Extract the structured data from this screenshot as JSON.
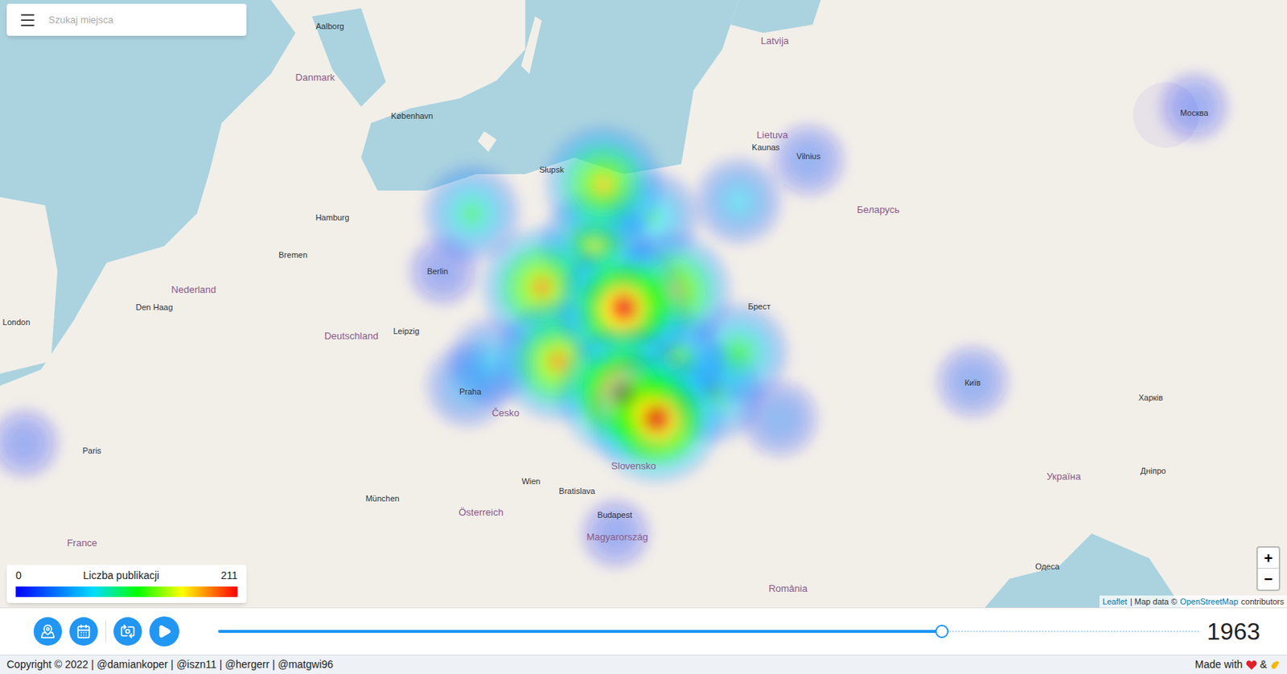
{
  "search": {
    "placeholder": "Szukaj miejsca"
  },
  "legend": {
    "min": "0",
    "title": "Liczba publikacji",
    "max": "211"
  },
  "zoom": {
    "in": "+",
    "out": "−"
  },
  "attribution": [
    "Leaflet",
    "| Map data ©",
    "OpenStreetMap",
    "contributors"
  ],
  "map_labels": [
    {
      "text": "Aalborg",
      "kind": "city"
    },
    {
      "text": "Danmark",
      "kind": "country"
    },
    {
      "text": "København",
      "kind": "city"
    },
    {
      "text": "Hamburg",
      "kind": "city"
    },
    {
      "text": "Bremen",
      "kind": "city"
    },
    {
      "text": "Berlin",
      "kind": "city"
    },
    {
      "text": "Nederland",
      "kind": "country"
    },
    {
      "text": "Den Haag",
      "kind": "city"
    },
    {
      "text": "London",
      "kind": "city"
    },
    {
      "text": "Deutschland",
      "kind": "country"
    },
    {
      "text": "Leipzig",
      "kind": "city"
    },
    {
      "text": "Praha",
      "kind": "city"
    },
    {
      "text": "Paris",
      "kind": "city"
    },
    {
      "text": "München",
      "kind": "city"
    },
    {
      "text": "Wien",
      "kind": "city"
    },
    {
      "text": "Bratislava",
      "kind": "city"
    },
    {
      "text": "Budapest",
      "kind": "city"
    },
    {
      "text": "Magyarország",
      "kind": "country"
    },
    {
      "text": "Słupsk",
      "kind": "city"
    },
    {
      "text": "Lietuva",
      "kind": "country"
    },
    {
      "text": "Vilnius",
      "kind": "city"
    },
    {
      "text": "Latvija",
      "kind": "country"
    },
    {
      "text": "Беларусь",
      "kind": "country"
    },
    {
      "text": "Україна",
      "kind": "country"
    },
    {
      "text": "Київ",
      "kind": "city"
    },
    {
      "text": "Москва",
      "kind": "city"
    },
    {
      "text": "România",
      "kind": "country"
    },
    {
      "text": "Slovensko",
      "kind": "country"
    },
    {
      "text": "Česko",
      "kind": "country"
    },
    {
      "text": "France",
      "kind": "country"
    },
    {
      "text": "Österreich",
      "kind": "country"
    },
    {
      "text": "Kaunas",
      "kind": "city"
    },
    {
      "text": "Брест",
      "kind": "city"
    },
    {
      "text": "Харків",
      "kind": "city"
    },
    {
      "text": "Одеса",
      "kind": "city"
    },
    {
      "text": "Дніпро",
      "kind": "city"
    }
  ],
  "heat_points": [
    {
      "level": 0.1
    },
    {
      "level": 0.1
    },
    {
      "level": 0.1
    },
    {
      "level": 0.1
    },
    {
      "level": 0.15
    },
    {
      "level": 0.15
    },
    {
      "level": 0.2
    },
    {
      "level": 0.3
    },
    {
      "level": 0.35
    },
    {
      "level": 0.35
    },
    {
      "level": 0.45
    },
    {
      "level": 0.5
    },
    {
      "level": 0.5
    },
    {
      "level": 0.55
    },
    {
      "level": 0.6
    },
    {
      "level": 0.7
    },
    {
      "level": 0.8
    },
    {
      "level": 0.8
    },
    {
      "level": 0.85
    },
    {
      "level": 0.85
    },
    {
      "level": 1.0
    },
    {
      "level": 1.0
    },
    {
      "level": 1.0
    }
  ],
  "timeline": {
    "level": 0.738,
    "year": "1963"
  },
  "footer": {
    "copyright": "Copyright © 2022 | @damiankoper | @iszn11 | @hergerr | @matgwi96",
    "made_with": "Made with",
    "and": "&"
  }
}
